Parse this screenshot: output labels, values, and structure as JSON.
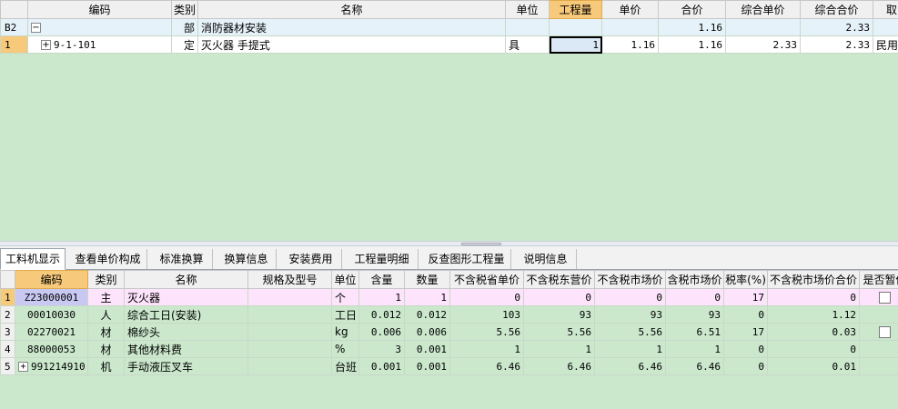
{
  "upper": {
    "columns": [
      "",
      "编码",
      "类别",
      "名称",
      "单位",
      "工程量",
      "单价",
      "合价",
      "综合单价",
      "综合合价",
      "取"
    ],
    "rows": [
      {
        "hdr": "B2",
        "expander": "−",
        "code": "",
        "type": "部",
        "name": "消防器材安装",
        "unit": "",
        "qty": "",
        "price": "",
        "total": "1.16",
        "comp_price": "",
        "comp_total": "2.33",
        "extra": ""
      },
      {
        "hdr": "1",
        "expander": "+",
        "code": "9-1-101",
        "type": "定",
        "name": "灭火器 手提式",
        "unit": "具",
        "qty": "1",
        "price": "1.16",
        "total": "1.16",
        "comp_price": "2.33",
        "comp_total": "2.33",
        "extra": "民用"
      }
    ]
  },
  "tabs": [
    "工料机显示",
    "查看单价构成",
    "标准换算",
    "换算信息",
    "安装费用",
    "工程量明细",
    "反查图形工程量",
    "说明信息"
  ],
  "lower": {
    "columns": [
      "",
      "编码",
      "类别",
      "名称",
      "规格及型号",
      "单位",
      "含量",
      "数量",
      "不含税省单价",
      "不含税东营价",
      "不含税市场价",
      "含税市场价",
      "税率(%)",
      "不含税市场价合价",
      "是否暂估"
    ],
    "rows": [
      {
        "hdr": "1",
        "code": "Z23000001",
        "type": "主",
        "name": "灭火器",
        "spec": "",
        "unit": "个",
        "content": "1",
        "amount": "1",
        "p1": "0",
        "p2": "0",
        "p3": "0",
        "p4": "0",
        "tax": "17",
        "sum": "0",
        "est": true
      },
      {
        "hdr": "2",
        "code": "00010030",
        "type": "人",
        "name": "综合工日(安装)",
        "spec": "",
        "unit": "工日",
        "content": "0.012",
        "amount": "0.012",
        "p1": "103",
        "p2": "93",
        "p3": "93",
        "p4": "93",
        "tax": "0",
        "sum": "1.12",
        "est": false
      },
      {
        "hdr": "3",
        "code": "02270021",
        "type": "材",
        "name": "棉纱头",
        "spec": "",
        "unit": "kg",
        "content": "0.006",
        "amount": "0.006",
        "p1": "5.56",
        "p2": "5.56",
        "p3": "5.56",
        "p4": "6.51",
        "tax": "17",
        "sum": "0.03",
        "est": true
      },
      {
        "hdr": "4",
        "code": "88000053",
        "type": "材",
        "name": "其他材料费",
        "spec": "",
        "unit": "%",
        "content": "3",
        "amount": "0.001",
        "p1": "1",
        "p2": "1",
        "p3": "1",
        "p4": "1",
        "tax": "0",
        "sum": "0",
        "est": false
      },
      {
        "hdr": "5",
        "code": "991214910",
        "type": "机",
        "name": "手动液压叉车",
        "spec": "",
        "unit": "台班",
        "content": "0.001",
        "amount": "0.001",
        "p1": "6.46",
        "p2": "6.46",
        "p3": "6.46",
        "p4": "6.46",
        "tax": "0",
        "sum": "0.01",
        "est": false
      }
    ]
  }
}
